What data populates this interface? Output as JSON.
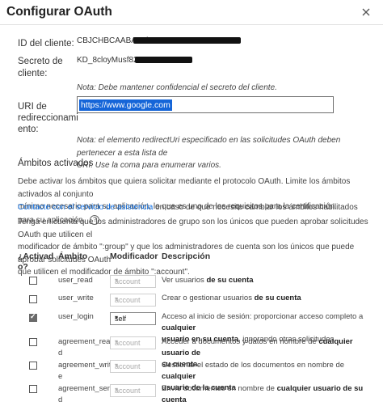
{
  "dialog": {
    "title": "Configurar OAuth",
    "client_id_label": "ID del cliente:",
    "client_id_value": "CBJCHBCAABAA1b",
    "client_secret_label_1": "Secreto de",
    "client_secret_label_2": "cliente:",
    "client_secret_value": "KD_8cloyMusf82",
    "secret_note": "Nota: Debe mantener confidencial el secreto del cliente.",
    "uri_label_1": "URI de",
    "uri_label_2": "redireccionami",
    "uri_label_3": "ento:",
    "uri_value": "https://www.google.com",
    "uri_note_1": "Nota: el elemento redirectUri especificado en las solicitudes OAuth deben pertenecer a esta lista de",
    "uri_note_2": "URI. Use la coma para enumerar varios.",
    "scopes_title": "Ámbitos activados",
    "scopes_para_1": "Debe activar los ámbitos que quiera solicitar mediante el protocolo OAuth. Limite los ámbitos activados al conjunto",
    "scopes_para_2": "mínimo necesario para su aplicación, lo que es uno de los requisitos para la certificación.",
    "support_link": "Contacte con el servicio de asistencia",
    "support_rest": " en caso de que necesite cambiar los ámbitos habilitados para su aplicación.",
    "admin_para_1": "Tenga en cuenta que los administradores de grupo son los únicos que pueden aprobar solicitudes OAuth que utilicen el",
    "admin_para_2": "modificador de ámbito \":group\" y que los administradores de cuenta son los únicos que puede aprobar solicitudes OAuth",
    "admin_para_3": "que utilicen el modificador de ámbito \":account\".",
    "col_active_1": "¿Activad",
    "col_active_2": "o?",
    "col_scope": "Ámbito",
    "col_modifier": "Modificador",
    "col_desc": "Descripción"
  },
  "rows": [
    {
      "checked": false,
      "scope_1": "user_read",
      "scope_2": "",
      "modifier": "account",
      "mod_active": false,
      "d1": "Ver usuarios ",
      "d1b": "de su cuenta",
      "d2": "",
      "d2b": ""
    },
    {
      "checked": false,
      "scope_1": "user_write",
      "scope_2": "",
      "modifier": "account",
      "mod_active": false,
      "d1": "Crear o gestionar usuarios ",
      "d1b": "de su cuenta",
      "d2": "",
      "d2b": ""
    },
    {
      "checked": true,
      "scope_1": "user_login",
      "scope_2": "",
      "modifier": "self",
      "mod_active": true,
      "d1": "Acceso al inicio de sesión: proporcionar acceso completo a ",
      "d1b": "cualquier",
      "d2": ", ignorando otras solicitudes",
      "d2b": "usuario en su cuenta"
    },
    {
      "checked": false,
      "scope_1": "agreement_rea",
      "scope_2": "d",
      "modifier": "account",
      "mod_active": false,
      "d1": "Acceder a documentos y datos en nombre de ",
      "d1b": "cualquier usuario de",
      "d2": "",
      "d2b": "su cuenta"
    },
    {
      "checked": false,
      "scope_1": "agreement_writ",
      "scope_2": "e",
      "modifier": "account",
      "mod_active": false,
      "d1": "Gestionar el estado de los documentos en nombre de ",
      "d1b": "cualquier",
      "d2": "",
      "d2b": "usuario de la cuenta"
    },
    {
      "checked": false,
      "scope_1": "agreement_sen",
      "scope_2": "d",
      "modifier": "account",
      "mod_active": false,
      "d1": "Envíe documentos en nombre de ",
      "d1b": "cualquier usuario de su cuenta",
      "d2": "",
      "d2b": ""
    }
  ]
}
